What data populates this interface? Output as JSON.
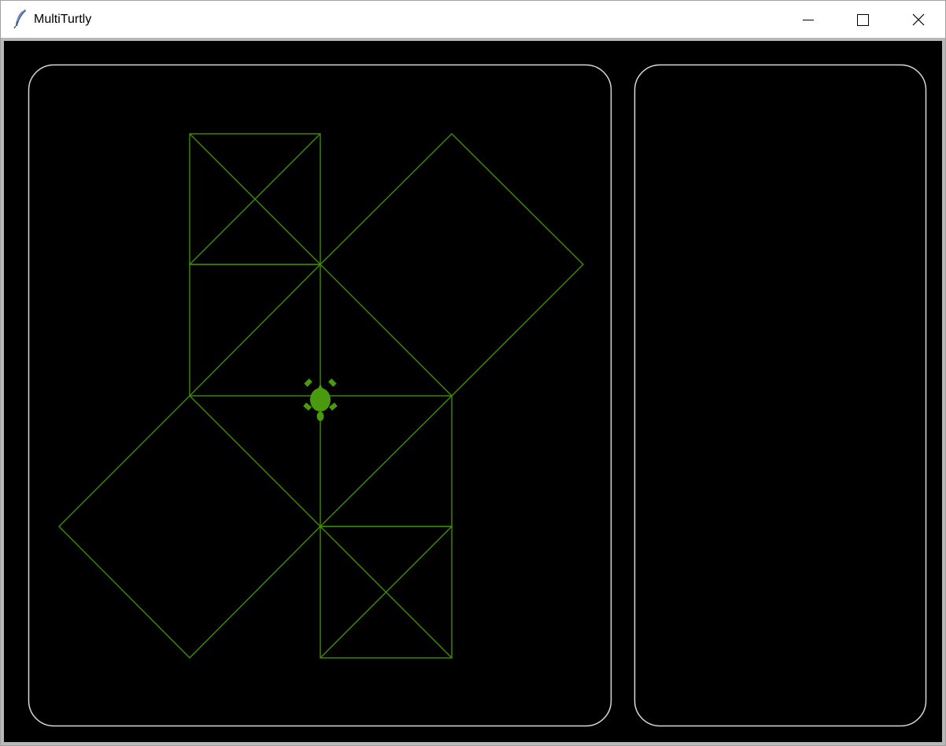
{
  "window": {
    "title": "MultiTurtly",
    "app_icon": "feather-icon",
    "controls": [
      "minimize-icon",
      "maximize-icon",
      "close-icon"
    ]
  },
  "canvas": {
    "background": "#000000",
    "panel_border_color": "#d8d8d8",
    "line_color": "#3f8d00",
    "turtle_color": "#4a9a10",
    "turtle_icon": "turtle-icon"
  }
}
